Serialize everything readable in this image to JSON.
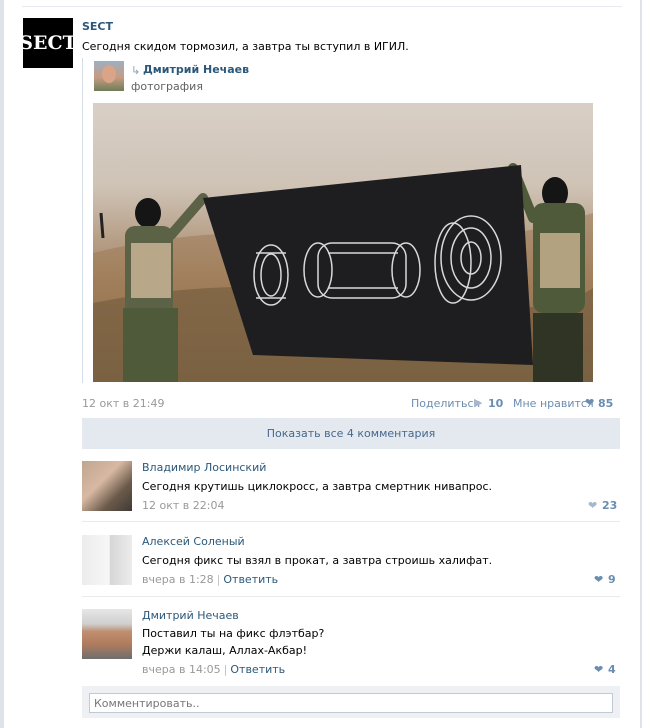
{
  "post": {
    "group_avatar_text": "SECT",
    "group_name": "SECT",
    "text": "Сегодня скидом тормозил, а завтра ты вступил в ИГИЛ.",
    "date": "12 окт в 21:49",
    "share_label": "Поделиться",
    "share_count": "10",
    "like_label": "Мне нравится",
    "like_count": "85"
  },
  "repost": {
    "author": "Дмитрий Нечаев",
    "type": "фотография"
  },
  "comments_header": {
    "show_all_label": "Показать все 4 комментария"
  },
  "comments": [
    {
      "author": "Владимир Лосинский",
      "text": "Сегодня крутишь циклокросс, а завтра смертник нивапрос.",
      "date": "12 окт в 22:04",
      "reply": "",
      "likes": "23"
    },
    {
      "author": "Алексей Соленый",
      "text": "Сегодня фикс ты взял в прокат, а завтра строишь халифат.",
      "date": "вчера в 1:28",
      "reply": "Ответить",
      "likes": "9"
    },
    {
      "author": "Дмитрий Нечаев",
      "text_line1": "Поставил ты на фикс флэтбар?",
      "text_line2": "Держи калаш, Аллах-Акбар!",
      "date": "вчера в 14:05",
      "reply": "Ответить",
      "likes": "4"
    }
  ],
  "comment_input": {
    "placeholder": "Комментировать.."
  },
  "colors": {
    "link": "#2b587a",
    "muted": "#999999",
    "like_active": "#6b8db0",
    "like_inactive": "#a5b8cc",
    "bar_bg": "#e4e9ef"
  },
  "icons": {
    "repost": "repost-arrow-icon",
    "share": "megaphone-icon",
    "like": "heart-icon"
  }
}
